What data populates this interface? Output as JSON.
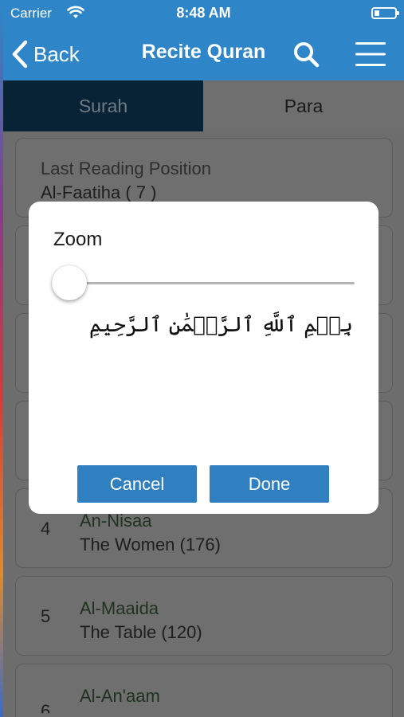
{
  "status": {
    "carrier": "Carrier",
    "time": "8:48 AM"
  },
  "nav": {
    "back_label": "Back",
    "title": "Recite Quran"
  },
  "tabs": [
    {
      "label": "Surah",
      "selected": true
    },
    {
      "label": "Para",
      "selected": false
    }
  ],
  "list": {
    "last_reading": {
      "title": "Last Reading Position",
      "value": "Al-Faatiha ( 7 )"
    },
    "items": [
      {
        "num": "4",
        "name": "An-Nisaa",
        "meaning": "The Women (176)"
      },
      {
        "num": "5",
        "name": "Al-Maaida",
        "meaning": "The Table (120)"
      },
      {
        "num": "6",
        "name": "Al-An'aam",
        "meaning": ""
      }
    ]
  },
  "dialog": {
    "title": "Zoom",
    "zoom_level": 0,
    "preview_text": "بِسۡمِ ٱللَّهِ ٱلرَّحۡمَٰنِ ٱلرَّحِيمِ",
    "cancel_label": "Cancel",
    "done_label": "Done"
  },
  "colors": {
    "accent": "#2e86c8",
    "tab_selected": "#082236",
    "button": "#2f7fc1"
  }
}
